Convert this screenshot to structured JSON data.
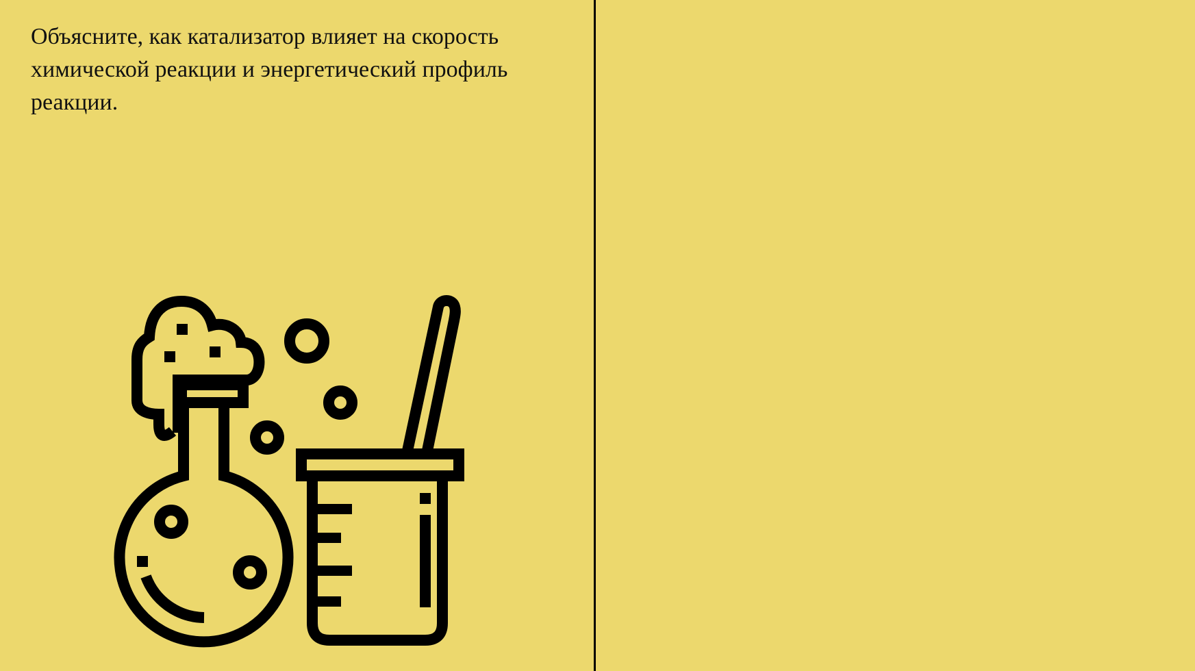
{
  "slide": {
    "question_text": "Объясните, как катализатор влияет на скорость химической реакции и энергетический профиль реакции.",
    "illustration_icon": "chemistry-flask-beaker-icon",
    "background_color": "#ecd86d",
    "ink_color": "#000000"
  }
}
